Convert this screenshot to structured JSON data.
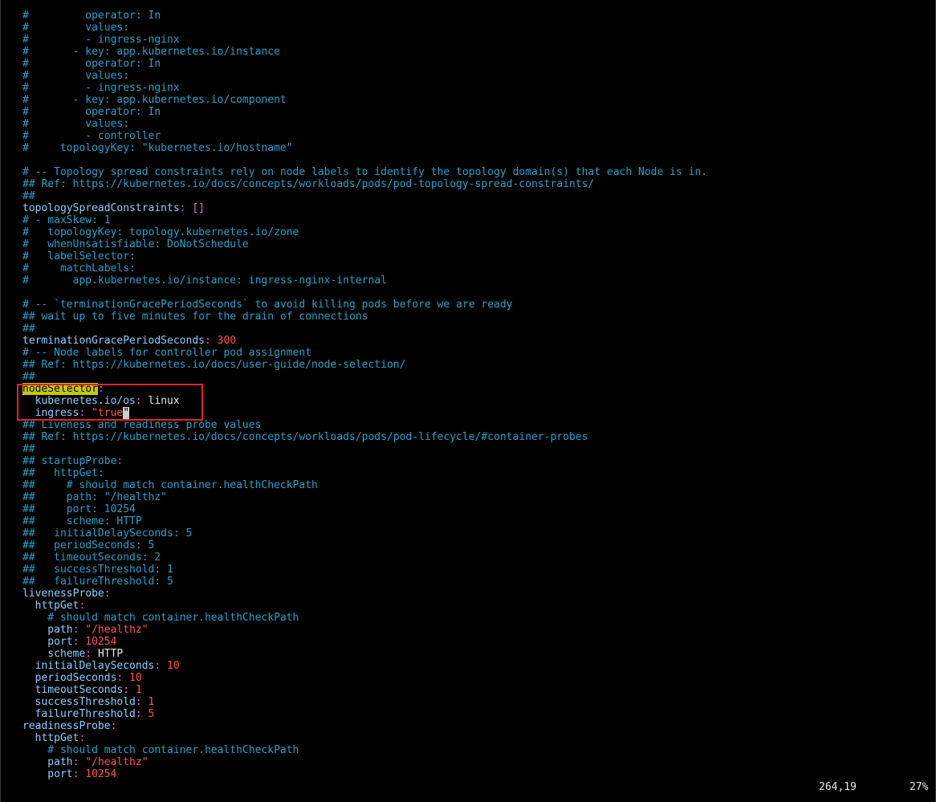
{
  "editor": {
    "lines": [
      [
        {
          "t": "#         operator: In",
          "c": "c"
        }
      ],
      [
        {
          "t": "#         values:",
          "c": "c"
        }
      ],
      [
        {
          "t": "#         - ingress-nginx",
          "c": "c"
        }
      ],
      [
        {
          "t": "#       - key: app.kubernetes.io/instance",
          "c": "c"
        }
      ],
      [
        {
          "t": "#         operator: In",
          "c": "c"
        }
      ],
      [
        {
          "t": "#         values:",
          "c": "c"
        }
      ],
      [
        {
          "t": "#         - ingress-nginx",
          "c": "c"
        }
      ],
      [
        {
          "t": "#       - key: app.kubernetes.io/component",
          "c": "c"
        }
      ],
      [
        {
          "t": "#         operator: In",
          "c": "c"
        }
      ],
      [
        {
          "t": "#         values:",
          "c": "c"
        }
      ],
      [
        {
          "t": "#         - controller",
          "c": "c"
        }
      ],
      [
        {
          "t": "#     topologyKey: \"kubernetes.io/hostname\"",
          "c": "c"
        }
      ],
      [],
      [
        {
          "t": "# -- Topology spread constraints rely on node labels to identify the topology domain(s) that each Node is in.",
          "c": "c"
        }
      ],
      [
        {
          "t": "## Ref: https://kubernetes.io/docs/concepts/workloads/pods/pod-topology-spread-constraints/",
          "c": "c"
        }
      ],
      [
        {
          "t": "##",
          "c": "c"
        }
      ],
      [
        {
          "t": "topologySpreadConstraints",
          "c": "k"
        },
        {
          "t": ": []",
          "c": "cl"
        }
      ],
      [
        {
          "t": "# - maxSkew: 1",
          "c": "c"
        }
      ],
      [
        {
          "t": "#   topologyKey: topology.kubernetes.io/zone",
          "c": "c"
        }
      ],
      [
        {
          "t": "#   whenUnsatisfiable: DoNotSchedule",
          "c": "c"
        }
      ],
      [
        {
          "t": "#   labelSelector:",
          "c": "c"
        }
      ],
      [
        {
          "t": "#     matchLabels:",
          "c": "c"
        }
      ],
      [
        {
          "t": "#       app.kubernetes.io/instance: ingress-nginx-internal",
          "c": "c"
        }
      ],
      [],
      [
        {
          "t": "# -- `terminationGracePeriodSeconds` to avoid killing pods before we are ready",
          "c": "c"
        }
      ],
      [
        {
          "t": "## wait up to five minutes for the drain of connections",
          "c": "c"
        }
      ],
      [
        {
          "t": "##",
          "c": "c"
        }
      ],
      [
        {
          "t": "terminationGracePeriodSeconds",
          "c": "k"
        },
        {
          "t": ": ",
          "c": "cl"
        },
        {
          "t": "300",
          "c": "n"
        }
      ],
      [
        {
          "t": "# -- Node labels for controller pod assignment",
          "c": "c"
        }
      ],
      [
        {
          "t": "## Ref: https://kubernetes.io/docs/user-guide/node-selection/",
          "c": "c"
        }
      ],
      [
        {
          "t": "##",
          "c": "c"
        }
      ],
      [
        {
          "t": "nodeSelector",
          "c": "hl"
        },
        {
          "t": ":",
          "c": "cl"
        }
      ],
      [
        {
          "t": "  kubernetes.io/os",
          "c": "k"
        },
        {
          "t": ": ",
          "c": "cl"
        },
        {
          "t": "linux",
          "c": "w"
        }
      ],
      [
        {
          "t": "  ingress",
          "c": "k"
        },
        {
          "t": ": ",
          "c": "cl"
        },
        {
          "t": "\"true",
          "c": "n"
        },
        {
          "t": "\"",
          "c": "cursor"
        }
      ],
      [
        {
          "t": "## Liveness and readiness probe values",
          "c": "c"
        }
      ],
      [
        {
          "t": "## Ref: https://kubernetes.io/docs/concepts/workloads/pods/pod-lifecycle/#container-probes",
          "c": "c"
        }
      ],
      [
        {
          "t": "##",
          "c": "c"
        }
      ],
      [
        {
          "t": "## startupProbe:",
          "c": "c"
        }
      ],
      [
        {
          "t": "##   httpGet:",
          "c": "c"
        }
      ],
      [
        {
          "t": "##     # should match container.healthCheckPath",
          "c": "c"
        }
      ],
      [
        {
          "t": "##     path: \"/healthz\"",
          "c": "c"
        }
      ],
      [
        {
          "t": "##     port: 10254",
          "c": "c"
        }
      ],
      [
        {
          "t": "##     scheme: HTTP",
          "c": "c"
        }
      ],
      [
        {
          "t": "##   initialDelaySeconds: 5",
          "c": "c"
        }
      ],
      [
        {
          "t": "##   periodSeconds: 5",
          "c": "c"
        }
      ],
      [
        {
          "t": "##   timeoutSeconds: 2",
          "c": "c"
        }
      ],
      [
        {
          "t": "##   successThreshold: 1",
          "c": "c"
        }
      ],
      [
        {
          "t": "##   failureThreshold: 5",
          "c": "c"
        }
      ],
      [
        {
          "t": "livenessProbe",
          "c": "k"
        },
        {
          "t": ":",
          "c": "cl"
        }
      ],
      [
        {
          "t": "  httpGet",
          "c": "k"
        },
        {
          "t": ":",
          "c": "cl"
        }
      ],
      [
        {
          "t": "    # should match container.healthCheckPath",
          "c": "c"
        }
      ],
      [
        {
          "t": "    path",
          "c": "k"
        },
        {
          "t": ": ",
          "c": "cl"
        },
        {
          "t": "\"/healthz\"",
          "c": "n"
        }
      ],
      [
        {
          "t": "    port",
          "c": "k"
        },
        {
          "t": ": ",
          "c": "cl"
        },
        {
          "t": "10254",
          "c": "n"
        }
      ],
      [
        {
          "t": "    scheme",
          "c": "k"
        },
        {
          "t": ": ",
          "c": "cl"
        },
        {
          "t": "HTTP",
          "c": "w"
        }
      ],
      [
        {
          "t": "  initialDelaySeconds",
          "c": "k"
        },
        {
          "t": ": ",
          "c": "cl"
        },
        {
          "t": "10",
          "c": "n"
        }
      ],
      [
        {
          "t": "  periodSeconds",
          "c": "k"
        },
        {
          "t": ": ",
          "c": "cl"
        },
        {
          "t": "10",
          "c": "n"
        }
      ],
      [
        {
          "t": "  timeoutSeconds",
          "c": "k"
        },
        {
          "t": ": ",
          "c": "cl"
        },
        {
          "t": "1",
          "c": "n"
        }
      ],
      [
        {
          "t": "  successThreshold",
          "c": "k"
        },
        {
          "t": ": ",
          "c": "cl"
        },
        {
          "t": "1",
          "c": "n"
        }
      ],
      [
        {
          "t": "  failureThreshold",
          "c": "k"
        },
        {
          "t": ": ",
          "c": "cl"
        },
        {
          "t": "5",
          "c": "n"
        }
      ],
      [
        {
          "t": "readinessProbe",
          "c": "k"
        },
        {
          "t": ":",
          "c": "cl"
        }
      ],
      [
        {
          "t": "  httpGet",
          "c": "k"
        },
        {
          "t": ":",
          "c": "cl"
        }
      ],
      [
        {
          "t": "    # should match container.healthCheckPath",
          "c": "c"
        }
      ],
      [
        {
          "t": "    path",
          "c": "k"
        },
        {
          "t": ": ",
          "c": "cl"
        },
        {
          "t": "\"/healthz\"",
          "c": "n"
        }
      ],
      [
        {
          "t": "    port",
          "c": "k"
        },
        {
          "t": ": ",
          "c": "cl"
        },
        {
          "t": "10254",
          "c": "n"
        }
      ]
    ]
  },
  "status": {
    "position": "264,19",
    "percent": "27%"
  },
  "colors": {
    "background": "#000000",
    "comment": "#2aa0c8",
    "key": "#8fd0ff",
    "punctuation": "#ff5bd0",
    "value_literal": "#ff5555",
    "value_plain": "#e8e8e8",
    "search_highlight": "#c8c800",
    "annotation_box": "#e0242a"
  }
}
